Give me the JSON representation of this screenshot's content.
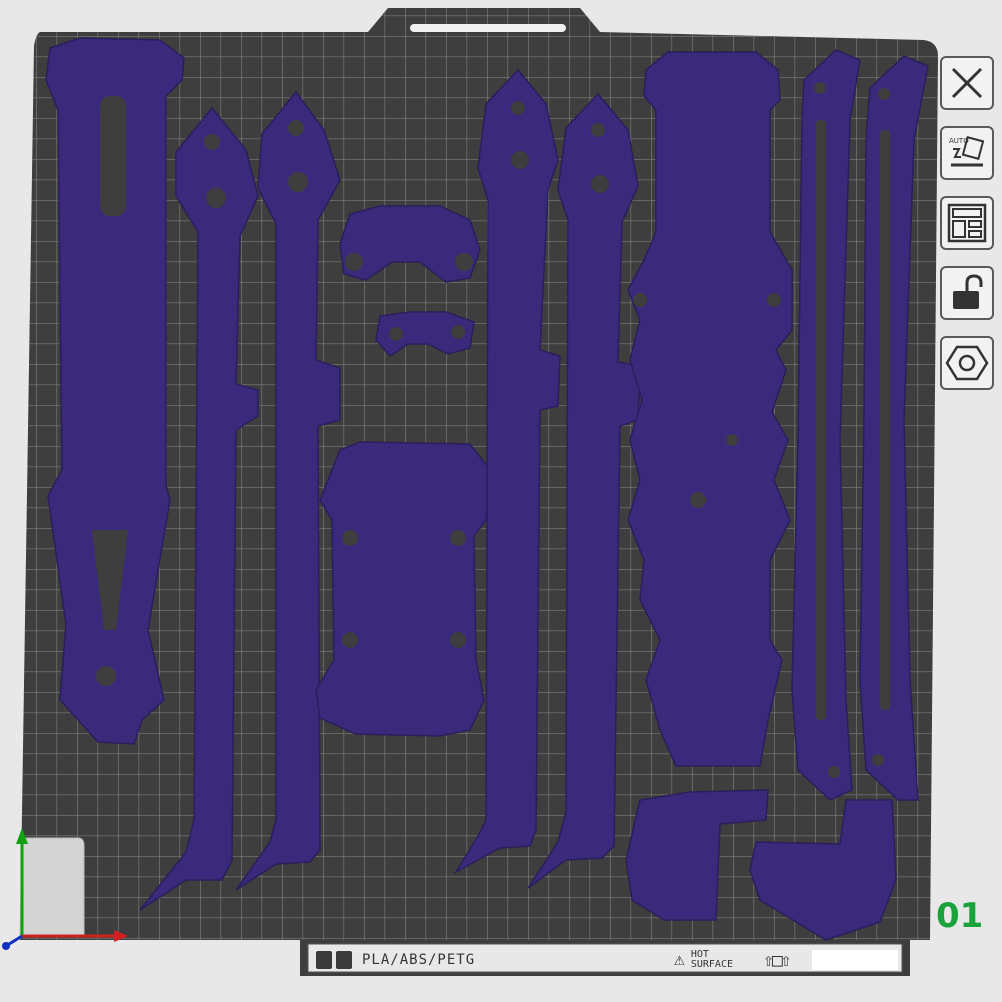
{
  "toolbar": {
    "buttons": [
      {
        "name": "close-button",
        "icon": "close-icon"
      },
      {
        "name": "auto-orient-button",
        "icon": "auto-orient-icon",
        "label": "AUTO"
      },
      {
        "name": "arrange-button",
        "icon": "arrange-icon"
      },
      {
        "name": "lock-button",
        "icon": "unlock-icon"
      },
      {
        "name": "settings-button",
        "icon": "hex-nut-icon"
      }
    ]
  },
  "plate": {
    "number": "01",
    "material_label": "PLA/ABS/PETG",
    "warning_line1": "HOT",
    "warning_line2": "SURFACE",
    "arrows": "⇧□⇧"
  },
  "colors": {
    "bed": "#3d3e3d",
    "grid": "#7c7d7a",
    "part": "#3b2a7c",
    "part_shadow": "#2a1e5c",
    "plate_number": "#1aa33a",
    "axis_x": "#d42020",
    "axis_y": "#10a010",
    "axis_z": "#1030c0"
  }
}
